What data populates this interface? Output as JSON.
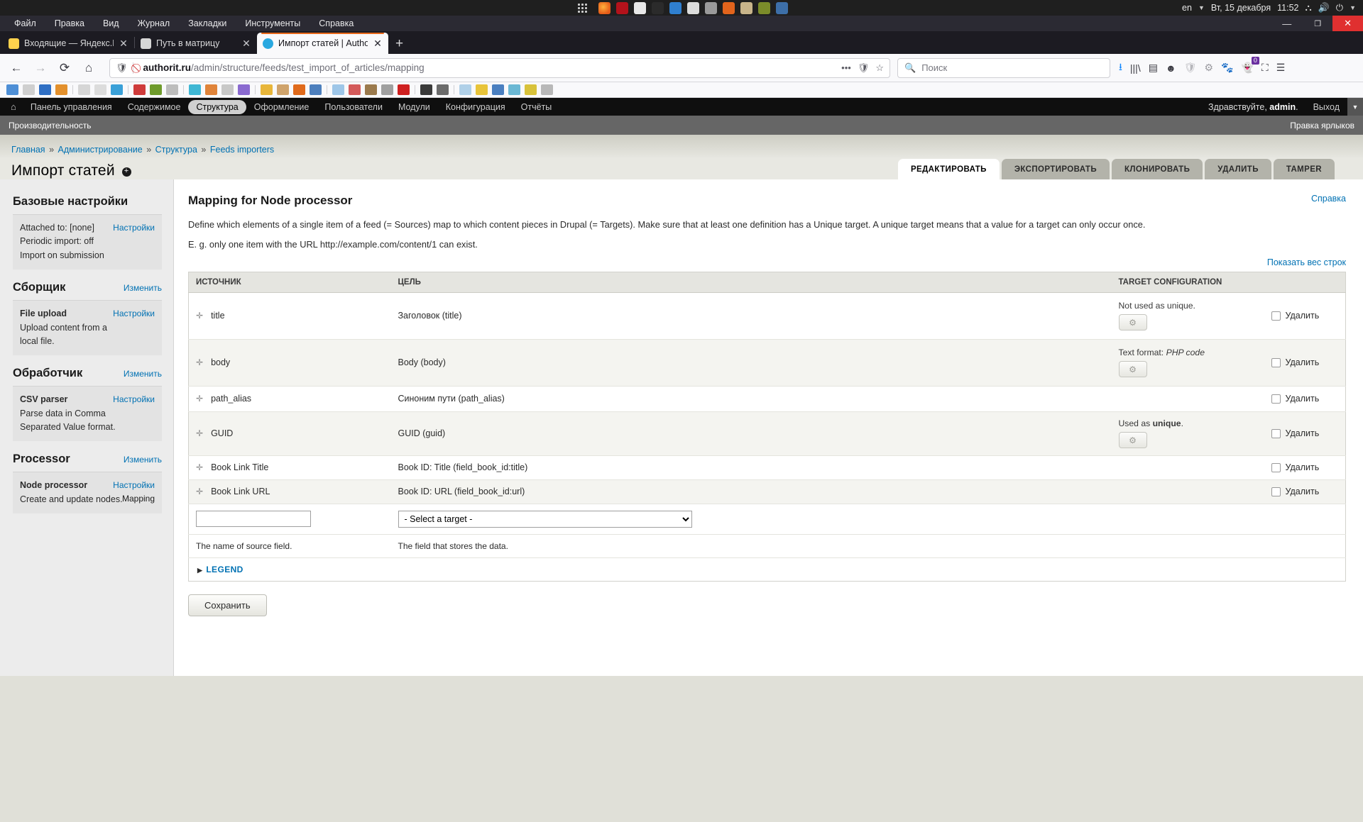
{
  "os": {
    "apps": [
      "apps-grid-icon",
      "firefox-icon",
      "filezilla-icon",
      "notes-icon",
      "gimp-icon",
      "blue-cone-icon",
      "pencil-icon",
      "images-icon",
      "audacity-icon",
      "archive-icon",
      "android-studio-icon",
      "network-tools-icon"
    ],
    "lang": "en",
    "date": "Вт, 15 декабря",
    "time": "11:52",
    "tray": [
      "network-icon",
      "volume-icon",
      "power-icon",
      "caret-down-icon"
    ]
  },
  "browser": {
    "tabs": [
      {
        "label": "Входящие — Яндекс.По",
        "favicon": "yandex-mail-icon",
        "active": false
      },
      {
        "label": "Путь в матрицу",
        "favicon": "page-icon",
        "active": false
      },
      {
        "label": "Импорт статей | Authori",
        "favicon": "drupal-icon",
        "active": true
      }
    ],
    "new_tab_label": "+",
    "close_glyph": "✕",
    "nav": {
      "back": "←",
      "forward": "→",
      "reload": "⟳",
      "home": "⌂"
    },
    "url_host": "authorit.ru",
    "url_path": "/admin/structure/feeds/test_import_of_articles/mapping",
    "url_right": [
      "•••",
      "shield-off-icon",
      "star-icon"
    ],
    "search_placeholder": "Поиск",
    "toolbar_icons": [
      "download-icon",
      "library-icon",
      "sidebar-icon",
      "account-icon",
      "shield-icon",
      "gear-icon",
      "gnome-icon",
      "ghostery-icon",
      "screenshot-icon",
      "menu-icon"
    ],
    "ghostery_badge": "0",
    "bookmarks_count": 30
  },
  "firefox_menu": [
    "Файл",
    "Правка",
    "Вид",
    "Журнал",
    "Закладки",
    "Инструменты",
    "Справка"
  ],
  "drupal_toolbar": {
    "home_icon": "home-icon",
    "items": [
      {
        "label": "Панель управления",
        "active": false
      },
      {
        "label": "Содержимое",
        "active": false
      },
      {
        "label": "Структура",
        "active": true
      },
      {
        "label": "Оформление",
        "active": false
      },
      {
        "label": "Пользователи",
        "active": false
      },
      {
        "label": "Модули",
        "active": false
      },
      {
        "label": "Конфигурация",
        "active": false
      },
      {
        "label": "Отчёты",
        "active": false
      }
    ],
    "greeting_prefix": "Здравствуйте, ",
    "greeting_user": "admin",
    "greeting_suffix": ".",
    "logout": "Выход"
  },
  "drupal_drawer": {
    "left": "Производительность",
    "right": "Правка ярлыков"
  },
  "breadcrumb": [
    {
      "label": "Главная"
    },
    {
      "label": "Администрирование"
    },
    {
      "label": "Структура"
    },
    {
      "label": "Feeds importers"
    }
  ],
  "breadcrumb_sep": "»",
  "page": {
    "title": "Импорт статей",
    "tabs": [
      {
        "label": "РЕДАКТИРОВАТЬ",
        "active": true
      },
      {
        "label": "ЭКСПОРТИРОВАТЬ",
        "active": false
      },
      {
        "label": "КЛОНИРОВАТЬ",
        "active": false
      },
      {
        "label": "УДАЛИТЬ",
        "active": false
      },
      {
        "label": "TAMPER",
        "active": false
      }
    ]
  },
  "sidebar": {
    "sections": [
      {
        "heading": "Базовые настройки",
        "heading_link": null,
        "body_lines": [
          "Attached to: [none]",
          "Periodic import: off",
          "Import on submission"
        ],
        "right_links": [
          "Настройки"
        ],
        "right_plain": []
      },
      {
        "heading": "Сборщик",
        "heading_link": "Изменить",
        "title": "File upload",
        "body_lines": [
          "Upload content from a local file."
        ],
        "right_links": [
          "Настройки"
        ],
        "right_plain": []
      },
      {
        "heading": "Обработчик",
        "heading_link": "Изменить",
        "title": "CSV parser",
        "body_lines": [
          "Parse data in Comma Separated Value format."
        ],
        "right_links": [
          "Настройки"
        ],
        "right_plain": []
      },
      {
        "heading": "Processor",
        "heading_link": "Изменить",
        "title": "Node processor",
        "body_lines": [
          "Create and update nodes."
        ],
        "right_links": [
          "Настройки"
        ],
        "right_plain": [
          "Mapping"
        ]
      }
    ]
  },
  "main": {
    "heading": "Mapping for Node processor",
    "help_link": "Справка",
    "description_1": "Define which elements of a single item of a feed (= Sources) map to which content pieces in Drupal (= Targets). Make sure that at least one definition has a Unique target. A unique target means that a value for a target can only occur once.",
    "description_2": "E. g. only one item with the URL http://example.com/content/1 can exist.",
    "show_weights": "Показать вес строк",
    "table": {
      "headers": [
        "ИСТОЧНИК",
        "ЦЕЛЬ",
        "TARGET CONFIGURATION",
        ""
      ],
      "rows": [
        {
          "source": "title",
          "target": "Заголовок (title)",
          "config_note": "Not used as unique.",
          "has_cog": true,
          "delete_label": "Удалить"
        },
        {
          "source": "body",
          "target": "Body (body)",
          "config_note": "Text format: PHP code",
          "has_cog": true,
          "delete_label": "Удалить"
        },
        {
          "source": "path_alias",
          "target": "Синоним пути (path_alias)",
          "config_note": "",
          "has_cog": false,
          "delete_label": "Удалить"
        },
        {
          "source": "GUID",
          "target": "GUID (guid)",
          "config_note": "Used as unique.",
          "has_cog": true,
          "delete_label": "Удалить"
        },
        {
          "source": "Book Link Title",
          "target": "Book ID: Title (field_book_id:title)",
          "config_note": "",
          "has_cog": false,
          "delete_label": "Удалить"
        },
        {
          "source": "Book Link URL",
          "target": "Book ID: URL (field_book_id:url)",
          "config_note": "",
          "has_cog": false,
          "delete_label": "Удалить"
        }
      ],
      "new_row": {
        "source_value": "",
        "source_hint": "The name of source field.",
        "target_selected": "- Select a target -",
        "target_hint": "The field that stores the data."
      }
    },
    "legend": "LEGEND",
    "save_button": "Сохранить"
  },
  "colors": {
    "accent_link": "#0071b3",
    "tab_active_bg": "#ffffff",
    "toolbar_bg": "#0f0f0f",
    "firefox_tab_accent": "#e8681a"
  }
}
